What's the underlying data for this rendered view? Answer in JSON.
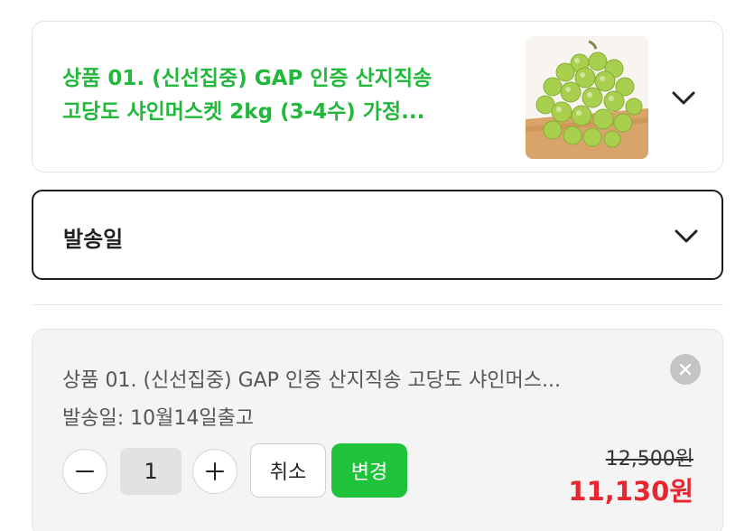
{
  "product": {
    "title_line1": "상품 01. (신선집중) GAP 인증 산지직송",
    "title_line2": "고당도 샤인머스켓 2kg (3-4수) 가정...",
    "image_icon": "grape-image",
    "expand_icon": "chevron-down-icon"
  },
  "ship_date_select": {
    "label": "발송일",
    "expand_icon": "chevron-down-icon"
  },
  "selected_option": {
    "name": "상품 01. (신선집중) GAP 인증 산지직송 고당도 샤인머스...",
    "ship_date": "발송일: 10월14일출고",
    "quantity": "1",
    "decrease_icon": "minus-icon",
    "increase_icon": "plus-icon",
    "remove_icon": "close-icon",
    "cancel_label": "취소",
    "change_label": "변경",
    "original_price": "12,500원",
    "sale_price": "11,130원"
  },
  "colors": {
    "accent_green": "#1fc33a",
    "title_green": "#22b83b",
    "price_red": "#e8262f"
  }
}
